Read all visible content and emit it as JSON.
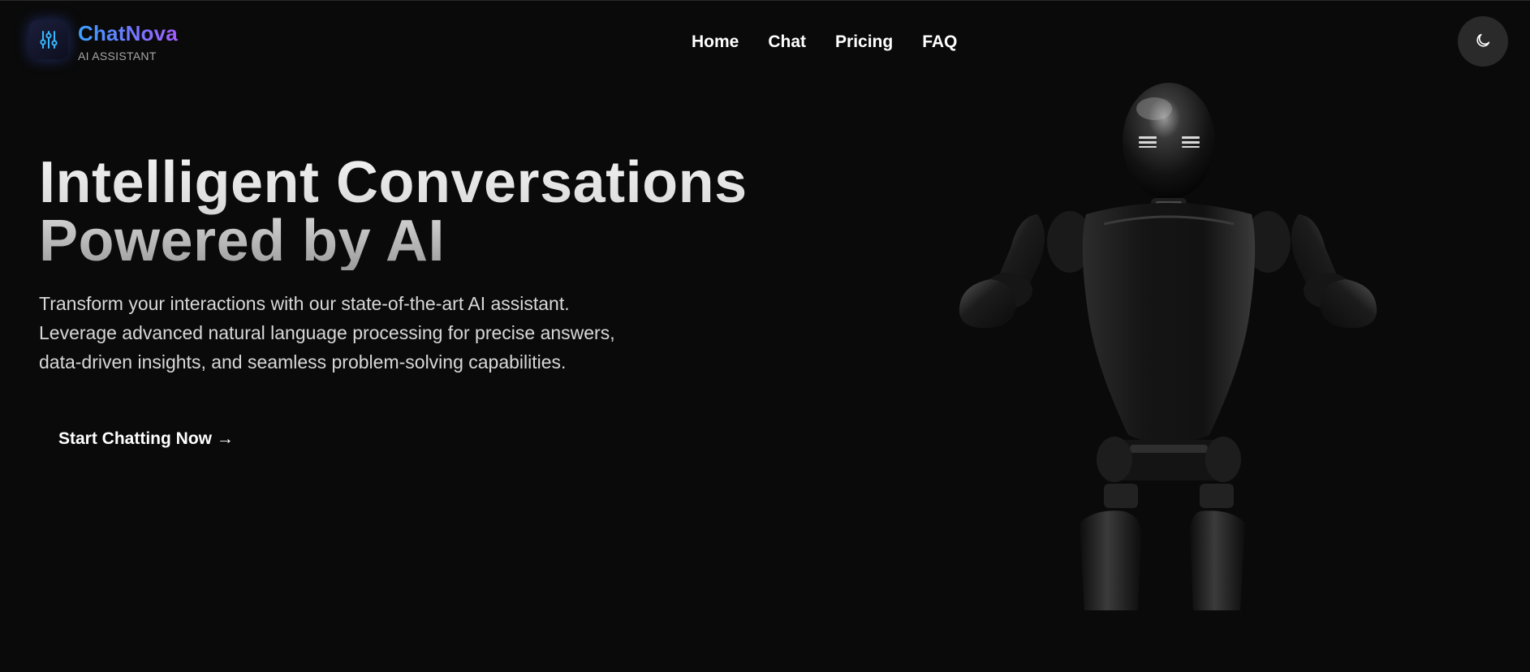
{
  "brand": {
    "name": "ChatNova",
    "subtitle": "AI ASSISTANT",
    "icon": "sliders-icon",
    "gradient": [
      "#3aa0ff",
      "#6c7bff",
      "#a35cff"
    ]
  },
  "nav": {
    "items": [
      {
        "label": "Home"
      },
      {
        "label": "Chat"
      },
      {
        "label": "Pricing"
      },
      {
        "label": "FAQ"
      }
    ]
  },
  "theme_toggle": {
    "icon": "moon-icon"
  },
  "hero": {
    "title_lines": [
      "Intelligent Conversations",
      "Powered by AI"
    ],
    "description_lines": [
      "Transform your interactions with our state-of-the-art AI assistant.",
      "Leverage advanced natural language processing for precise answers,",
      "data-driven insights, and seamless problem-solving capabilities."
    ],
    "cta_label": "Start Chatting Now →",
    "image": "humanoid-robot-illustration"
  },
  "colors": {
    "background": "#0a0a0a",
    "text": "#ffffff",
    "muted": "#a7a7a7",
    "toggle_bg": "#2a2a2a"
  }
}
